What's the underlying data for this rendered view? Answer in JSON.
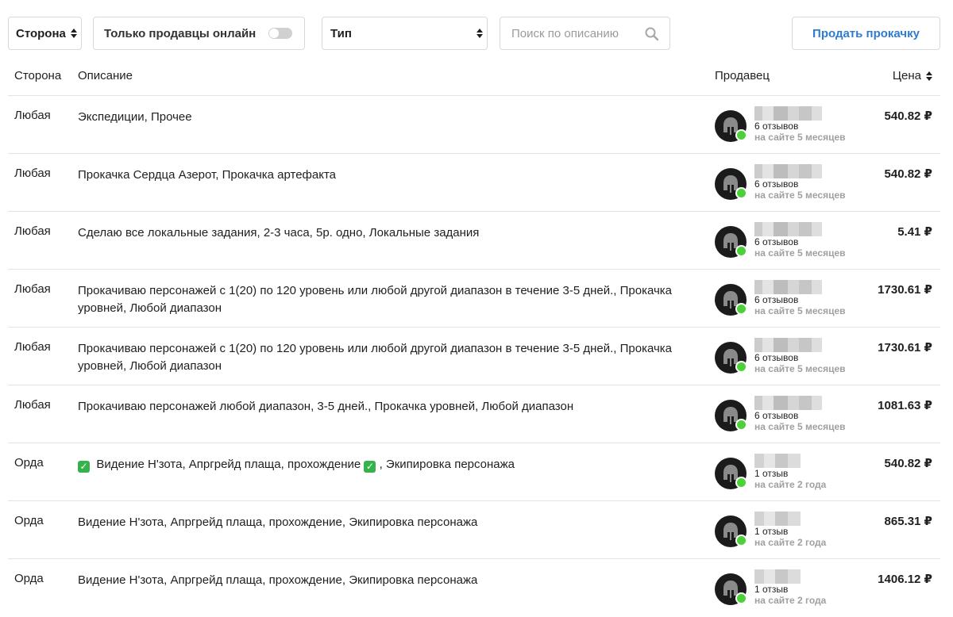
{
  "filters": {
    "side_label": "Сторона",
    "online_label": "Только продавцы онлайн",
    "type_label": "Тип",
    "search_placeholder": "Поиск по описанию",
    "sell_button": "Продать прокачку"
  },
  "table": {
    "headers": {
      "side": "Сторона",
      "description": "Описание",
      "seller": "Продавец",
      "price": "Цена"
    },
    "rows": [
      {
        "side": "Любая",
        "description": "Экспедиции, Прочее",
        "reviews": "6 отзывов",
        "on_site": "на сайте 5 месяцев",
        "price": "540.82 ₽"
      },
      {
        "side": "Любая",
        "description": "Прокачка Сердца Азерот, Прокачка артефакта",
        "reviews": "6 отзывов",
        "on_site": "на сайте 5 месяцев",
        "price": "540.82 ₽"
      },
      {
        "side": "Любая",
        "description": "Сделаю все локальные задания, 2-3 часа, 5р. одно, Локальные задания",
        "reviews": "6 отзывов",
        "on_site": "на сайте 5 месяцев",
        "price": "5.41 ₽"
      },
      {
        "side": "Любая",
        "description": "Прокачиваю персонажей с 1(20) по 120 уровень или любой другой диапазон в течение 3-5 дней., Прокачка уровней, Любой диапазон",
        "reviews": "6 отзывов",
        "on_site": "на сайте 5 месяцев",
        "price": "1730.61 ₽"
      },
      {
        "side": "Любая",
        "description": "Прокачиваю персонажей с 1(20) по 120 уровень или любой другой диапазон в течение 3-5 дней., Прокачка уровней, Любой диапазон",
        "reviews": "6 отзывов",
        "on_site": "на сайте 5 месяцев",
        "price": "1730.61 ₽"
      },
      {
        "side": "Любая",
        "description": "Прокачиваю персонажей любой диапазон, 3-5 дней., Прокачка уровней, Любой диапазон",
        "reviews": "6 отзывов",
        "on_site": "на сайте 5 месяцев",
        "price": "1081.63 ₽"
      },
      {
        "side": "Орда",
        "desc_part1": "Видение Н'зота, Апргрейд плаща, прохождение",
        "desc_part2": ", Экипировка персонажа",
        "check_icon": "check-emoji-icon",
        "reviews": "1 отзыв",
        "on_site": "на сайте 2 года",
        "price": "540.82 ₽"
      },
      {
        "side": "Орда",
        "description": "Видение Н'зота, Апргрейд плаща, прохождение, Экипировка персонажа",
        "reviews": "1 отзыв",
        "on_site": "на сайте 2 года",
        "price": "865.31 ₽"
      },
      {
        "side": "Орда",
        "description": "Видение Н'зота, Апргрейд плаща, прохождение, Экипировка персонажа",
        "reviews": "1 отзыв",
        "on_site": "на сайте 2 года",
        "price": "1406.12 ₽"
      }
    ]
  },
  "colors": {
    "accent": "#2f7bd1",
    "online": "#4cd138",
    "border": "#d9d9d9"
  }
}
